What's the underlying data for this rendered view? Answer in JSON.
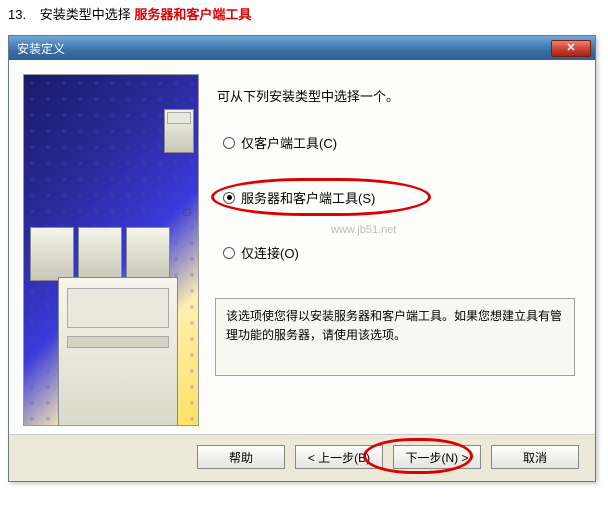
{
  "instruction": {
    "number": "13.",
    "prefix": "安装类型中选择",
    "highlight": "服务器和客户端工具"
  },
  "window": {
    "title": "安装定义",
    "close": "✕"
  },
  "content": {
    "heading": "可从下列安装类型中选择一个。",
    "options": {
      "client_only": "仅客户端工具(C)",
      "server_client": "服务器和客户端工具(S)",
      "connect_only": "仅连接(O)"
    },
    "watermark": "www.jb51.net",
    "description": "该选项使您得以安装服务器和客户端工具。如果您想建立具有管理功能的服务器，请使用该选项。"
  },
  "buttons": {
    "help": "帮助",
    "back": "< 上一步(B)",
    "next": "下一步(N) >",
    "cancel": "取消"
  }
}
